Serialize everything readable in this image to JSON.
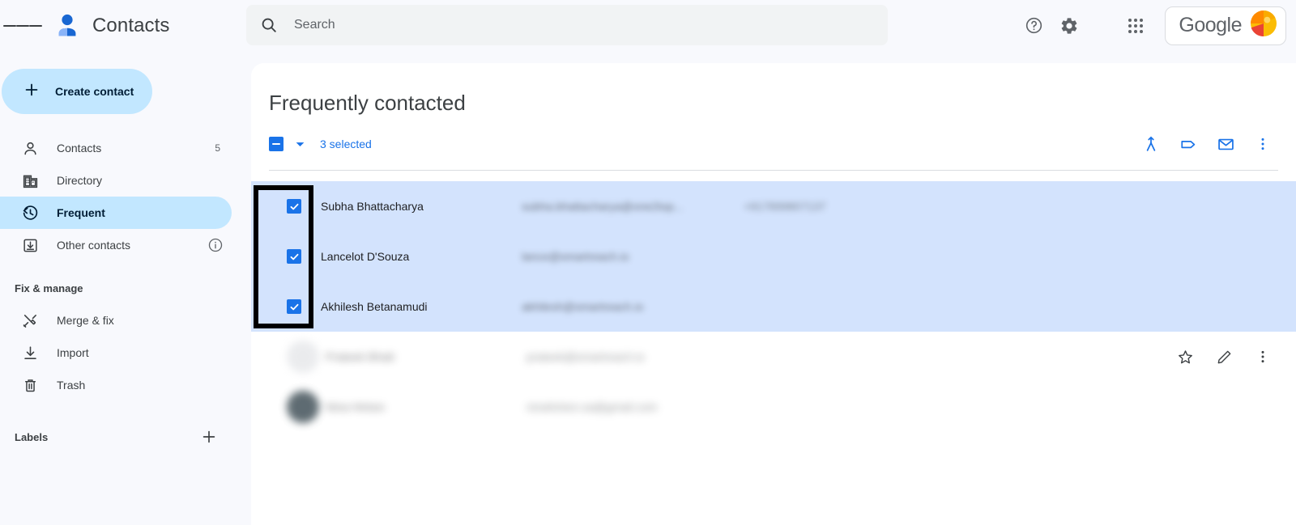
{
  "app": {
    "title": "Contacts",
    "menu_icon": "hamburger-menu-icon",
    "logo_icon": "contacts-person-icon"
  },
  "search": {
    "placeholder": "Search",
    "value": "",
    "icon": "search-icon"
  },
  "top_actions": [
    {
      "name": "help-button",
      "icon": "help-circle-icon"
    },
    {
      "name": "settings-button",
      "icon": "gear-icon"
    },
    {
      "name": "apps-button",
      "icon": "grid-apps-icon"
    }
  ],
  "account": {
    "brand_text": "Google",
    "avatar_icon": "google-account-avatar"
  },
  "sidebar": {
    "create_button": {
      "label": "Create contact",
      "icon": "plus-icon"
    },
    "items": [
      {
        "label": "Contacts",
        "icon": "person-icon",
        "count": "5",
        "active": false
      },
      {
        "label": "Directory",
        "icon": "building-icon",
        "count": "",
        "active": false
      },
      {
        "label": "Frequent",
        "icon": "history-clock-icon",
        "count": "",
        "active": true
      },
      {
        "label": "Other contacts",
        "icon": "inbox-download-icon",
        "count": "",
        "active": false,
        "info_icon": "info-circle-icon"
      }
    ],
    "fix_manage_label": "Fix & manage",
    "manage_items": [
      {
        "label": "Merge & fix",
        "icon": "merge-tools-icon"
      },
      {
        "label": "Import",
        "icon": "import-download-icon"
      },
      {
        "label": "Trash",
        "icon": "trash-icon"
      }
    ],
    "labels_label": "Labels",
    "add_label_icon": "plus-icon"
  },
  "main": {
    "title": "Frequently contacted",
    "selection": {
      "checkbox_state": "indeterminate",
      "caret_icon": "chevron-down-icon",
      "text": "3 selected",
      "accent_color": "#1a73e8"
    },
    "toolbar_actions": [
      {
        "name": "merge-button",
        "icon": "merge-icon"
      },
      {
        "name": "manage-labels-button",
        "icon": "label-tag-icon"
      },
      {
        "name": "send-email-button",
        "icon": "envelope-icon"
      },
      {
        "name": "more-options-button",
        "icon": "more-vertical-icon"
      }
    ],
    "rows": [
      {
        "name": "Subha Bhattacharya",
        "email": "subha.bhattacharya@one2top...",
        "phone": "+917899807137",
        "selected": true,
        "obscured": false
      },
      {
        "name": "Lancelot D'Souza",
        "email": "lance@smartreach.io",
        "phone": "",
        "selected": true,
        "obscured": false
      },
      {
        "name": "Akhilesh Betanamudi",
        "email": "akhilesh@smartreach.io",
        "phone": "",
        "selected": true,
        "obscured": false
      },
      {
        "name": "Prateek Bhatt",
        "email": "prateek@smartreach.io",
        "phone": "",
        "selected": false,
        "obscured": true,
        "avatar": "grey"
      },
      {
        "name": "Nina Hinton",
        "email": "ninahinton.sa@gmail.com",
        "phone": "",
        "selected": false,
        "obscured": true,
        "avatar": "teal"
      }
    ],
    "row_actions": [
      {
        "name": "star-button",
        "icon": "star-outline-icon"
      },
      {
        "name": "edit-button",
        "icon": "pencil-icon"
      },
      {
        "name": "row-more-button",
        "icon": "more-vertical-icon"
      }
    ]
  },
  "annotation": {
    "highlight_color": "#000000",
    "target": "checkbox-column"
  }
}
